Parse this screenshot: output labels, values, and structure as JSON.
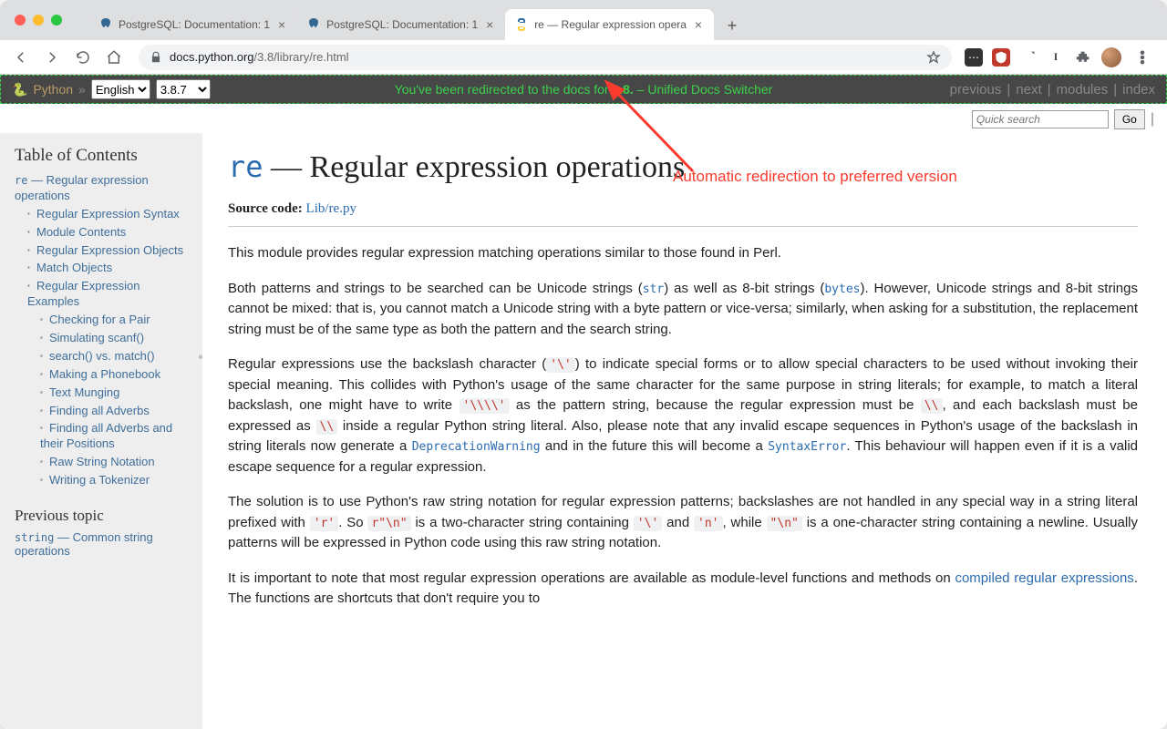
{
  "browser": {
    "tabs": [
      {
        "title": "PostgreSQL: Documentation: 1",
        "active": false,
        "favicon": "postgres"
      },
      {
        "title": "PostgreSQL: Documentation: 1",
        "active": false,
        "favicon": "postgres"
      },
      {
        "title": "re — Regular expression opera",
        "active": true,
        "favicon": "python"
      }
    ],
    "url_domain": "docs.python.org",
    "url_path": "/3.8/library/re.html"
  },
  "banner": {
    "py_label": "Python",
    "lang": "English",
    "version": "3.8.7",
    "message_pre": "You've been redirected to the docs for ",
    "message_ver": "3.8.",
    "message_post": " – Unified Docs Switcher",
    "nav": {
      "previous": "previous",
      "next": "next",
      "modules": "modules",
      "index": "index"
    }
  },
  "search": {
    "placeholder": "Quick search",
    "go": "Go"
  },
  "sidebar": {
    "toc_heading": "Table of Contents",
    "toc": {
      "root_label_code": "re",
      "root_label_rest": " — Regular expression operations",
      "items": [
        {
          "label": "Regular Expression Syntax"
        },
        {
          "label": "Module Contents"
        },
        {
          "label": "Regular Expression Objects"
        },
        {
          "label": "Match Objects"
        },
        {
          "label": "Regular Expression Examples",
          "children": [
            {
              "label": "Checking for a Pair"
            },
            {
              "label": "Simulating scanf()"
            },
            {
              "label": "search() vs. match()"
            },
            {
              "label": "Making a Phonebook"
            },
            {
              "label": "Text Munging"
            },
            {
              "label": "Finding all Adverbs"
            },
            {
              "label": "Finding all Adverbs and their Positions"
            },
            {
              "label": "Raw String Notation"
            },
            {
              "label": "Writing a Tokenizer"
            }
          ]
        }
      ]
    },
    "prev_heading": "Previous topic",
    "prev_code": "string",
    "prev_rest": " — Common string operations"
  },
  "main": {
    "title_code": "re",
    "title_rest": " — Regular expression operations",
    "source_label": "Source code:",
    "source_link": "Lib/re.py",
    "p1": "This module provides regular expression matching operations similar to those found in Perl.",
    "p2_a": "Both patterns and strings to be searched can be Unicode strings (",
    "p2_str": "str",
    "p2_b": ") as well as 8-bit strings (",
    "p2_bytes": "bytes",
    "p2_c": "). However, Unicode strings and 8-bit strings cannot be mixed: that is, you cannot match a Unicode string with a byte pattern or vice-versa; similarly, when asking for a substitution, the replacement string must be of the same type as both the pattern and the search string.",
    "p3_a": "Regular expressions use the backslash character (",
    "p3_bs": "'\\'",
    "p3_b": ") to indicate special forms or to allow special characters to be used without invoking their special meaning. This collides with Python's usage of the same character for the same purpose in string literals; for example, to match a literal backslash, one might have to write ",
    "p3_lit1": "'\\\\\\\\'",
    "p3_c": " as the pattern string, because the regular expression must be ",
    "p3_lit2": "\\\\",
    "p3_d": ", and each backslash must be expressed as ",
    "p3_lit3": "\\\\",
    "p3_e": " inside a regular Python string literal. Also, please note that any invalid escape sequences in Python's usage of the backslash in string literals now generate a ",
    "p3_dw": "DeprecationWarning",
    "p3_f": " and in the future this will become a ",
    "p3_se": "SyntaxError",
    "p3_g": ". This behaviour will happen even if it is a valid escape sequence for a regular expression.",
    "p4_a": "The solution is to use Python's raw string notation for regular expression patterns; backslashes are not handled in any special way in a string literal prefixed with ",
    "p4_r": "'r'",
    "p4_b": ". So ",
    "p4_rn": "r\"\\n\"",
    "p4_c": " is a two-character string containing ",
    "p4_bs2": "'\\'",
    "p4_d": " and ",
    "p4_n": "'n'",
    "p4_e": ", while ",
    "p4_qn": "\"\\n\"",
    "p4_f": " is a one-character string containing a newline. Usually patterns will be expressed in Python code using this raw string notation.",
    "p5_a": "It is important to note that most regular expression operations are available as module-level functions and methods on ",
    "p5_link": "compiled regular expressions",
    "p5_b": ". The functions are shortcuts that don't require you to"
  },
  "annotation": {
    "text": "Automatic redirection to preferred version"
  }
}
